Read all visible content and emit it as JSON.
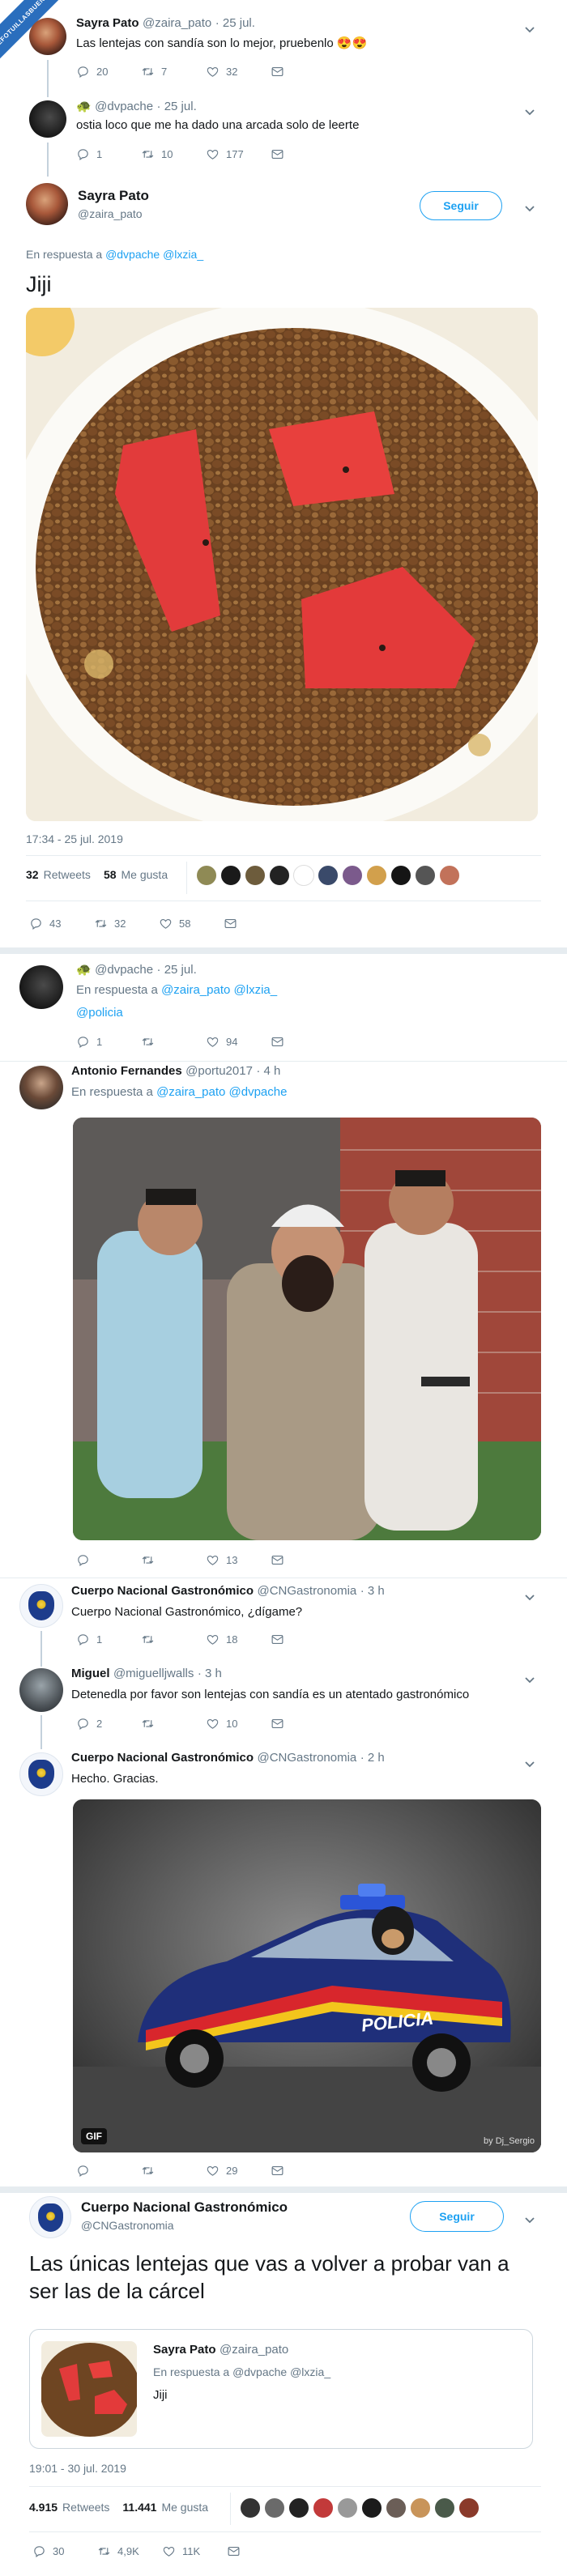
{
  "watermark": {
    "text": "VEFOTUILLASBUENNAS"
  },
  "tweet1": {
    "name": "Sayra Pato",
    "handle": "@zaira_pato",
    "date": "· 25 jul.",
    "text": "Las lentejas con sandía son lo mejor,  pruebenlo 😍😍",
    "replies": "20",
    "retweets": "7",
    "likes": "32"
  },
  "tweet2": {
    "name": "🐢",
    "handle": "@dvpache",
    "date": "· 25 jul.",
    "text": "ostia loco que me ha dado una arcada solo de leerte",
    "replies": "1",
    "retweets": "10",
    "likes": "177"
  },
  "main1": {
    "name": "Sayra Pato",
    "handle": "@zaira_pato",
    "follow": "Seguir",
    "reply_prefix": "En respuesta a",
    "reply_to": "@dvpache @lxzia_",
    "text": "Jiji",
    "timestamp": "17:34 - 25 jul. 2019",
    "rt_count": "32",
    "rt_label": "Retweets",
    "like_count": "58",
    "like_label": "Me gusta",
    "replies": "43",
    "retweets": "32",
    "likes": "58"
  },
  "reply1": {
    "name": "🐢",
    "handle": "@dvpache",
    "date": "· 25 jul.",
    "reply_prefix": "En respuesta a",
    "reply_to": "@zaira_pato @lxzia_",
    "text": "@policia",
    "replies": "1",
    "retweets": "",
    "likes": "94"
  },
  "reply2": {
    "name": "Antonio Fernandes",
    "handle": "@portu2017",
    "date": "· 4 h",
    "reply_prefix": "En respuesta a",
    "reply_to": "@zaira_pato @dvpache",
    "replies": "",
    "retweets": "",
    "likes": "13"
  },
  "reply3": {
    "name": "Cuerpo Nacional Gastronómico",
    "handle": "@CNGastronomia",
    "date": "· 3 h",
    "text": "Cuerpo Nacional Gastronómico, ¿dígame?",
    "replies": "1",
    "retweets": "",
    "likes": "18"
  },
  "reply4": {
    "name": "Miguel",
    "handle": "@miguelljwalls",
    "date": "· 3 h",
    "text": "Detenedla por favor son lentejas con sandía es un atentado gastronómico",
    "replies": "2",
    "retweets": "",
    "likes": "10"
  },
  "reply5": {
    "name": "Cuerpo Nacional Gastronómico",
    "handle": "@CNGastronomia",
    "date": "· 2 h",
    "text": "Hecho. Gracias.",
    "gif": "GIF",
    "car_text": "POLICIA",
    "credit": "by Dj_Sergio",
    "replies": "",
    "retweets": "",
    "likes": "29"
  },
  "main2": {
    "name": "Cuerpo Nacional Gastronómico",
    "handle": "@CNGastronomia",
    "follow": "Seguir",
    "text": "Las únicas lentejas que vas a volver a probar van a ser las de la cárcel",
    "quote_name": "Sayra Pato",
    "quote_handle": "@zaira_pato",
    "quote_reply_prefix": "En respuesta a",
    "quote_reply_to": "@dvpache @lxzia_",
    "quote_text": "Jiji",
    "timestamp": "19:01 - 30 jul. 2019",
    "rt_count": "4.915",
    "rt_label": "Retweets",
    "like_count": "11.441",
    "like_label": "Me gusta",
    "replies": "30",
    "retweets": "4,9K",
    "likes": "11K"
  },
  "colors": {
    "accent": "#1da1f2",
    "muted": "#657786",
    "text": "#14171a",
    "border": "#e6ecf0",
    "watermark": "#2a6ebd"
  }
}
